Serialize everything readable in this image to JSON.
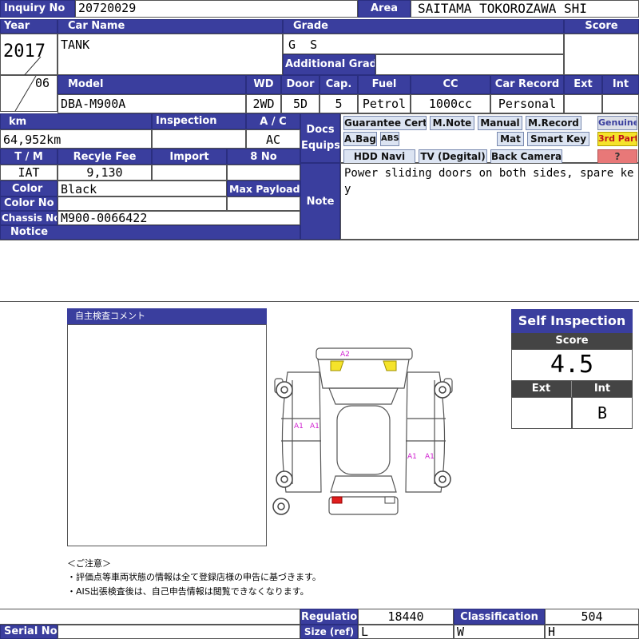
{
  "header": {
    "inquiry_label": "Inquiry No",
    "inquiry_value": "20720029",
    "area_label": "Area",
    "area_value": "SAITAMA TOKOROZAWA SHI"
  },
  "row1": {
    "year_label": "Year",
    "carname_label": "Car Name",
    "grade_label": "Grade",
    "score_label": "Score",
    "year_value": "2017",
    "month_value": "06",
    "carname_value": "TANK",
    "grade_value": "G  S",
    "addgrade_label": "Additional Grade"
  },
  "row2": {
    "model_label": "Model",
    "wd_label": "WD",
    "door_label": "Door",
    "cap_label": "Cap.",
    "fuel_label": "Fuel",
    "cc_label": "CC",
    "record_label": "Car Record",
    "ext_label": "Ext",
    "int_label": "Int",
    "model_value": "DBA-M900A",
    "wd_value": "2WD",
    "door_value": "5D",
    "cap_value": "5",
    "fuel_value": "Petrol",
    "cc_value": "1000cc",
    "record_value": "Personal"
  },
  "row3": {
    "km_label": "km",
    "inspection_label": "Inspection",
    "ac_label": "A / C",
    "km_value": "64,952km",
    "ac_value": "AC",
    "tm_label": "T / M",
    "recycle_label": "Recyle Fee",
    "import_label": "Import",
    "no8_label": "8 No",
    "tm_value": "IAT",
    "recycle_value": "9,130",
    "color_label": "Color",
    "color_value": "Black",
    "maxpayload_label": "Max Payload",
    "colorno_label": "Color No",
    "chassis_label": "Chassis No",
    "chassis_value": "M900-0066422",
    "notice_label": "Notice"
  },
  "docs": {
    "label_line1": "Docs",
    "label_line2": "Equips",
    "tags": [
      "Guarantee Cert",
      "M.Note",
      "Manual",
      "M.Record",
      "Genuine",
      "A.Bag",
      "ABS",
      "Mat",
      "Smart Key",
      "3rd Party",
      "HDD Navi",
      "TV (Degital)",
      "Back Camera",
      "?"
    ]
  },
  "note": {
    "label": "Note",
    "text": "Power sliding doors on both sides, spare key"
  },
  "inspection_comment": {
    "title": "自主検査コメント"
  },
  "self_inspection": {
    "title": "Self Inspection",
    "score_label": "Score",
    "score_value": "4.5",
    "ext_label": "Ext",
    "int_label": "Int",
    "ext_value": "",
    "int_value": "B"
  },
  "diagram": {
    "marks": [
      "A2",
      "A1",
      "A1",
      "A1",
      "A1"
    ],
    "colors": {
      "yellow": "#f5e32a",
      "red": "#e01e1e",
      "mark_text": "#d020d0"
    }
  },
  "notes_jp": {
    "heading": "＜ご注意＞",
    "line1": "・評価点等車両状態の情報は全て登録店様の申告に基づきます。",
    "line2": "・AIS出張検査後は、自己申告情報は閲覧できなくなります。"
  },
  "footer": {
    "regulation_label": "Regulation",
    "regulation_value": "18440",
    "classification_label": "Classification",
    "classification_value": "504",
    "serial_label": "Serial No",
    "size_label": "Size (ref)",
    "size_l": "L",
    "size_w": "W",
    "size_h": "H"
  },
  "colors": {
    "header_bg": "#3a3e9e",
    "tag_bg": "#dce4f2",
    "third_party": "#f5e32a",
    "question": "#e87878"
  }
}
